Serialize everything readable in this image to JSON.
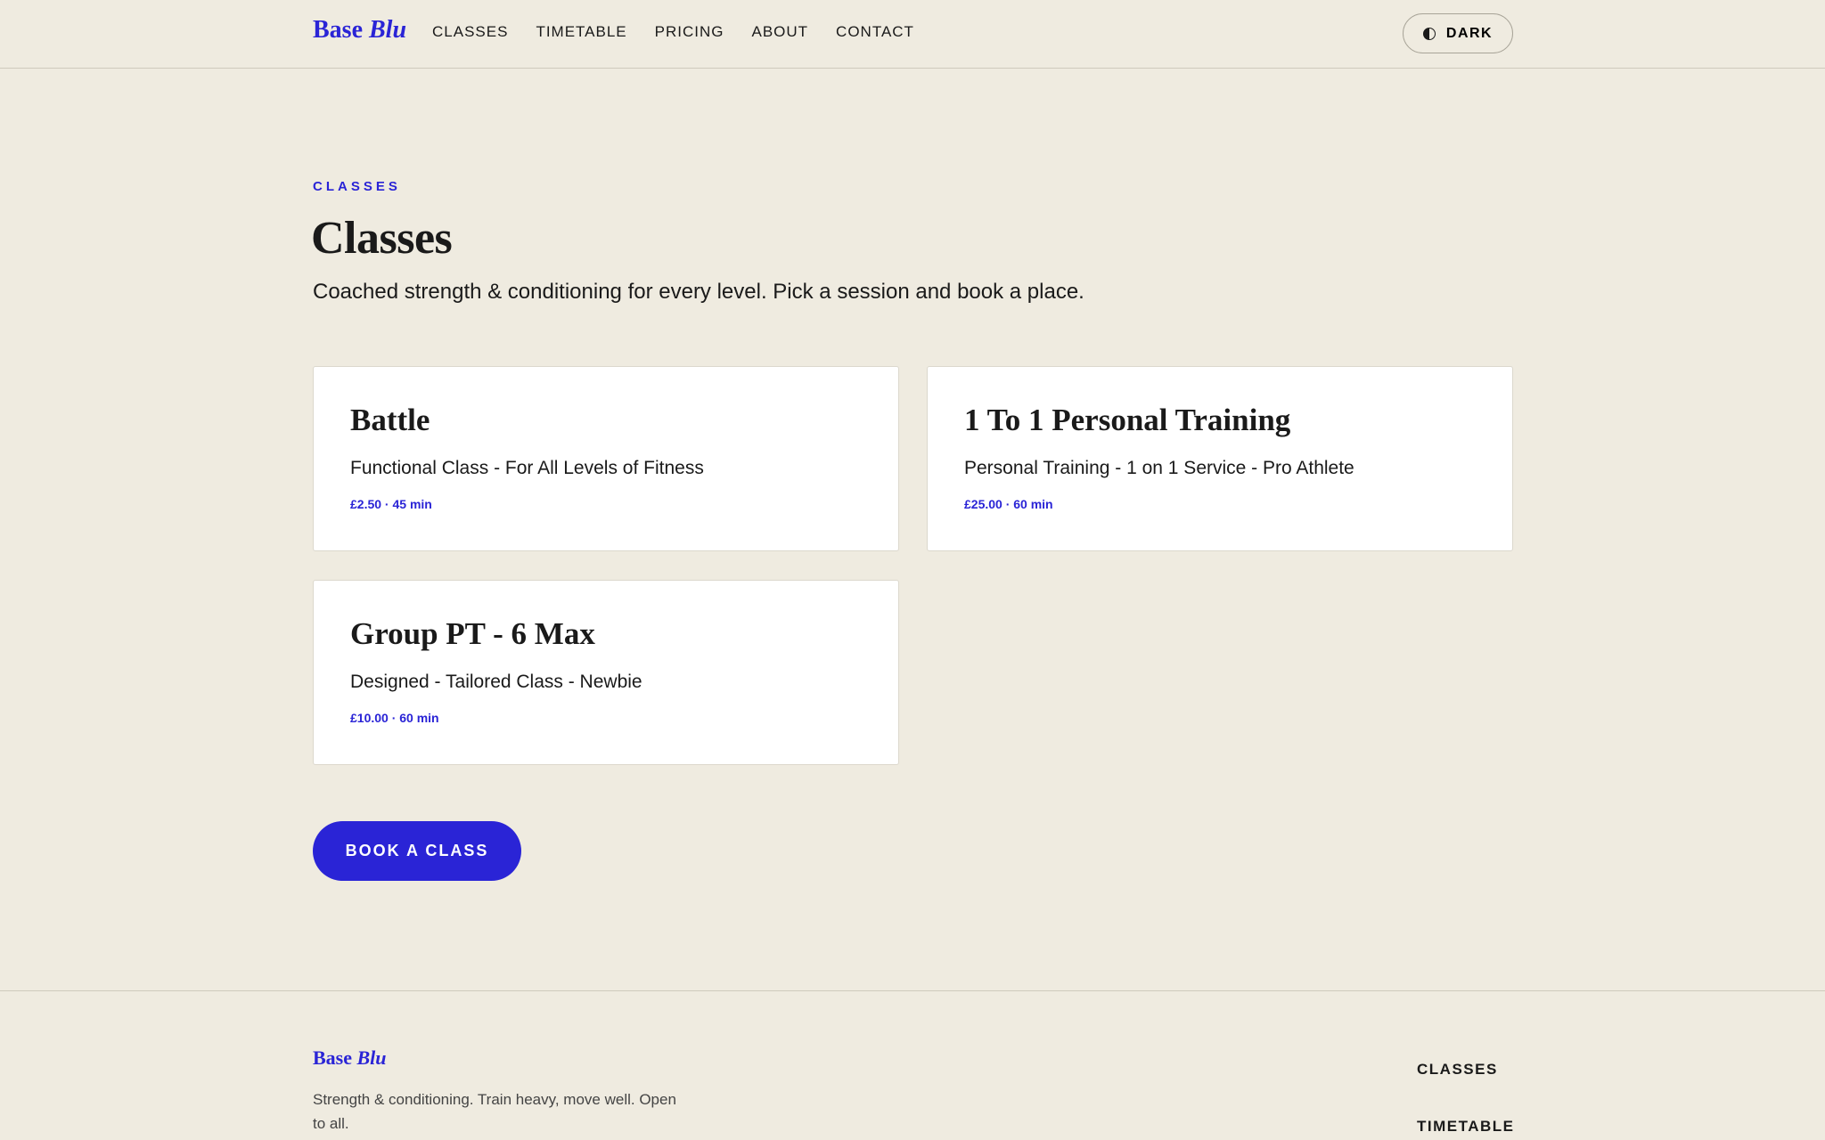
{
  "header": {
    "logo_word": "Base",
    "logo_accent": "Blu",
    "nav": [
      "CLASSES",
      "TIMETABLE",
      "PRICING",
      "ABOUT",
      "CONTACT"
    ],
    "theme_toggle_label": "DARK",
    "theme_toggle_icon": "contrast-icon"
  },
  "main": {
    "eyebrow": "CLASSES",
    "title": "Classes",
    "subtitle": "Coached strength & conditioning for every level. Pick a session and book a place.",
    "cards": [
      {
        "title": "Battle",
        "description": "Functional Class - For All Levels of Fitness",
        "meta": "£2.50 · 45 min"
      },
      {
        "title": "1 To 1 Personal Training",
        "description": "Personal Training - 1 on 1 Service - Pro Athlete",
        "meta": "£25.00 · 60 min"
      },
      {
        "title": "Group PT - 6 Max",
        "description": "Designed - Tailored Class - Newbie",
        "meta": "£10.00 · 60 min"
      }
    ],
    "book_button": "BOOK A CLASS"
  },
  "footer": {
    "logo_word": "Base",
    "logo_accent": "Blu",
    "tagline": "Strength & conditioning. Train heavy, move well. Open to all.",
    "nav": [
      "CLASSES",
      "TIMETABLE"
    ]
  },
  "colors": {
    "accent": "#2a24d6",
    "background": "#efebe0",
    "card": "#ffffff"
  }
}
